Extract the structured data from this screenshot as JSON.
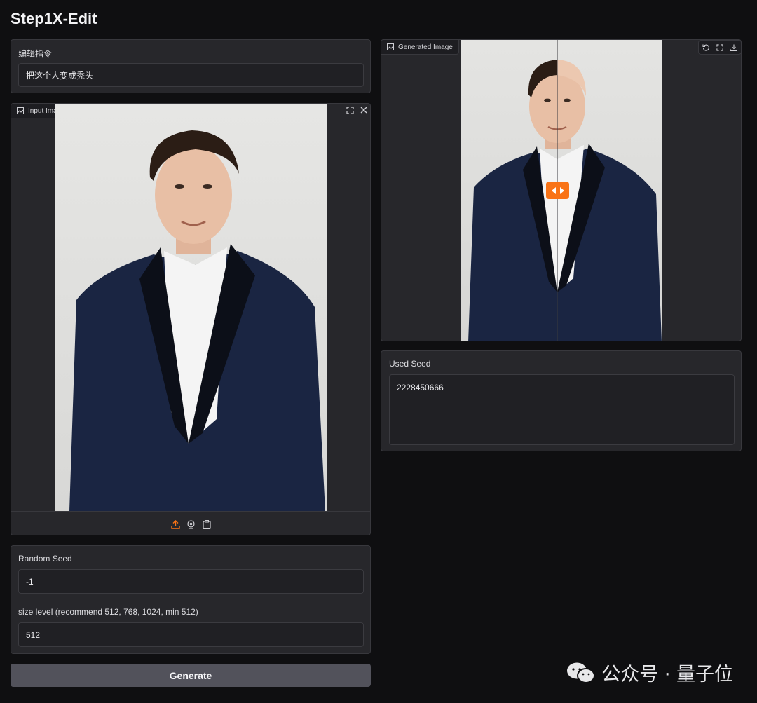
{
  "app": {
    "title": "Step1X-Edit"
  },
  "instruction": {
    "label": "编辑指令",
    "value": "把这个人变成秃头"
  },
  "input_image": {
    "label": "Input Image"
  },
  "generated_image": {
    "label": "Generated Image"
  },
  "used_seed": {
    "label": "Used Seed",
    "value": "2228450666"
  },
  "random_seed": {
    "label": "Random Seed",
    "value": "-1"
  },
  "size_level": {
    "label": "size level (recommend 512, 768, 1024, min 512)",
    "value": "512"
  },
  "generate": {
    "label": "Generate"
  },
  "watermark": {
    "text": "公众号 · 量子位"
  },
  "colors": {
    "accent": "#f97316",
    "panel": "#27272b",
    "background": "#0f0f11"
  }
}
